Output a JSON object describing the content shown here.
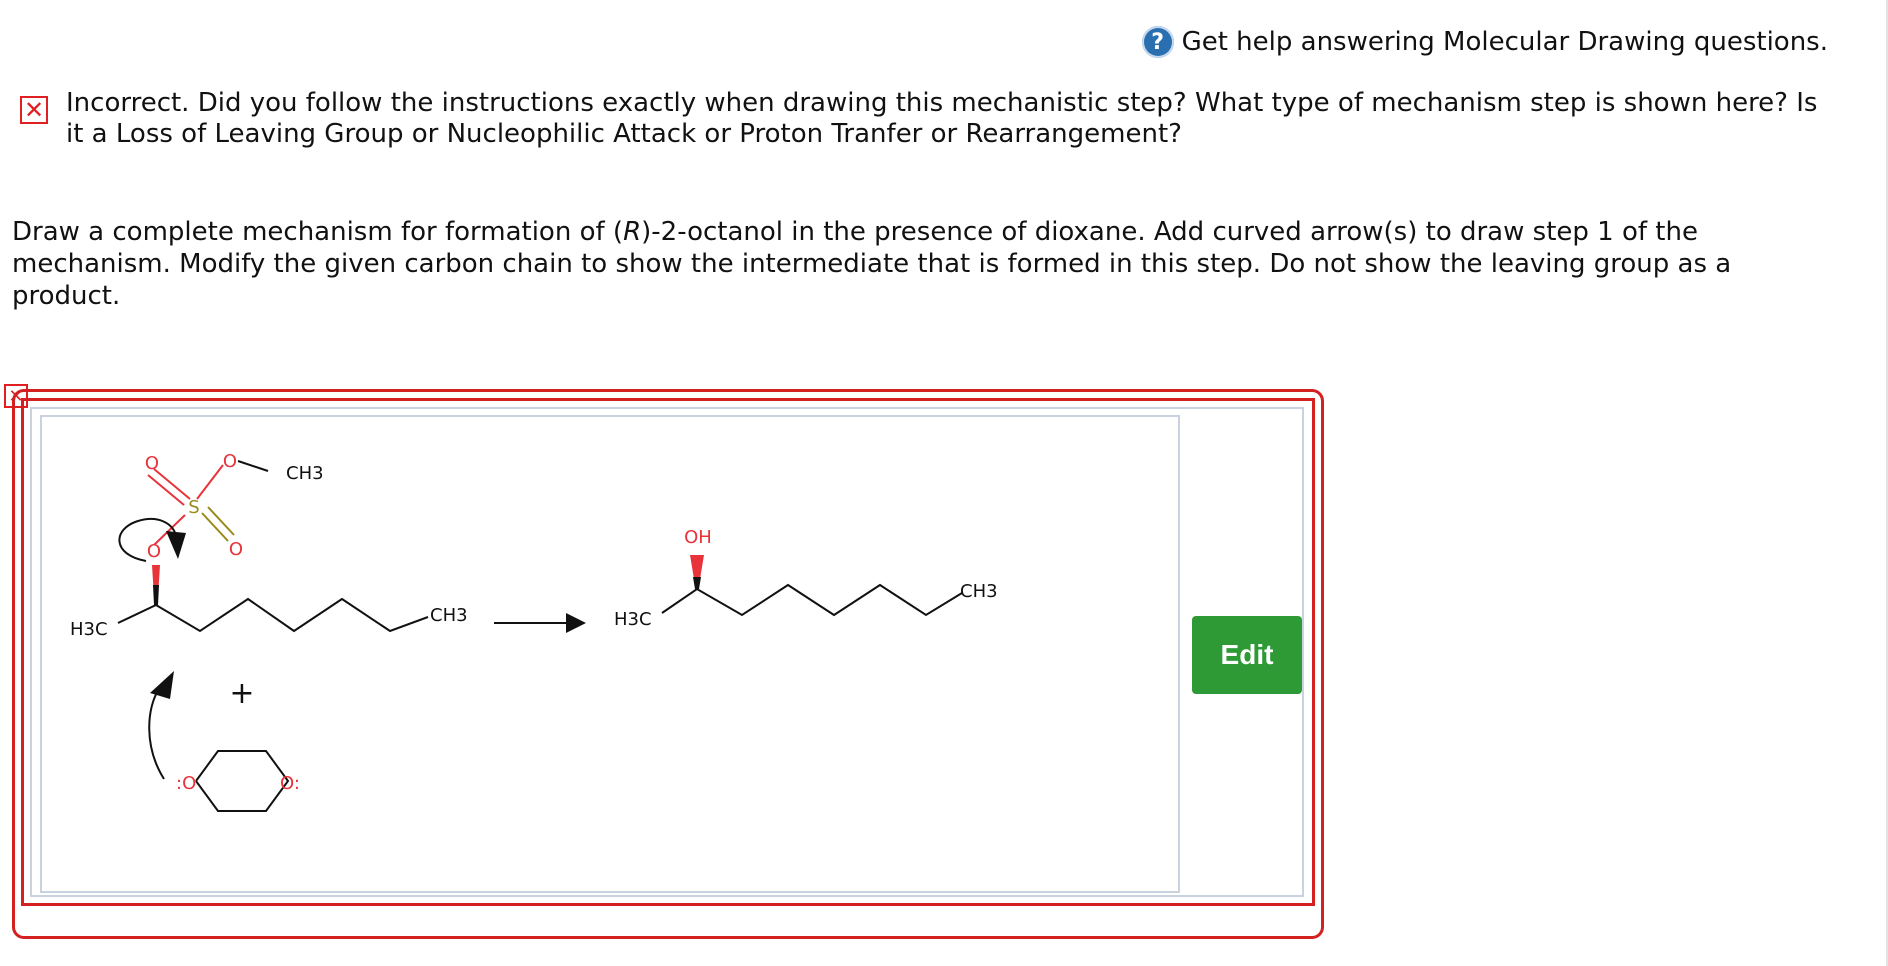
{
  "help": {
    "icon": "help-icon",
    "text": "Get help answering Molecular Drawing questions."
  },
  "feedback": {
    "icon": "error-icon",
    "icon_glyph": "✕",
    "text": "Incorrect. Did you follow the instructions exactly when drawing this mechanistic step? What type of mechanism step is shown here? Is it a Loss of Leaving Group or Nucleophilic Attack or Proton Tranfer or Rearrangement?"
  },
  "question": {
    "part1": "Draw a complete mechanism for formation of (",
    "italic": "R",
    "part2": ")-2-octanol in the presence of dioxane. Add curved arrow(s) to draw step 1 of the mechanism. Modify the given carbon chain to show the intermediate that is formed in this step. Do not show the leaving group as a product."
  },
  "drawing": {
    "status_icon_glyph": "✕",
    "labels": {
      "o_top_left": "O",
      "o_methoxy": "O",
      "ch3_top": "CH3",
      "s": "S",
      "o_sulfonyl_right": "O",
      "o_link": "O",
      "h3c_left": "H3C",
      "ch3_chain1": "CH3",
      "oh": "OH",
      "h3c_product": "H3C",
      "ch3_product": "CH3",
      "plus": "+",
      "o_dioxane_left": ":O",
      "o_dioxane_right": "O:"
    }
  },
  "edit_button": "Edit",
  "colors": {
    "error_red": "#d32020",
    "edit_green": "#2e9a35",
    "oxygen_red": "#e8333a",
    "sulfur_olive": "#9a8a1a"
  }
}
